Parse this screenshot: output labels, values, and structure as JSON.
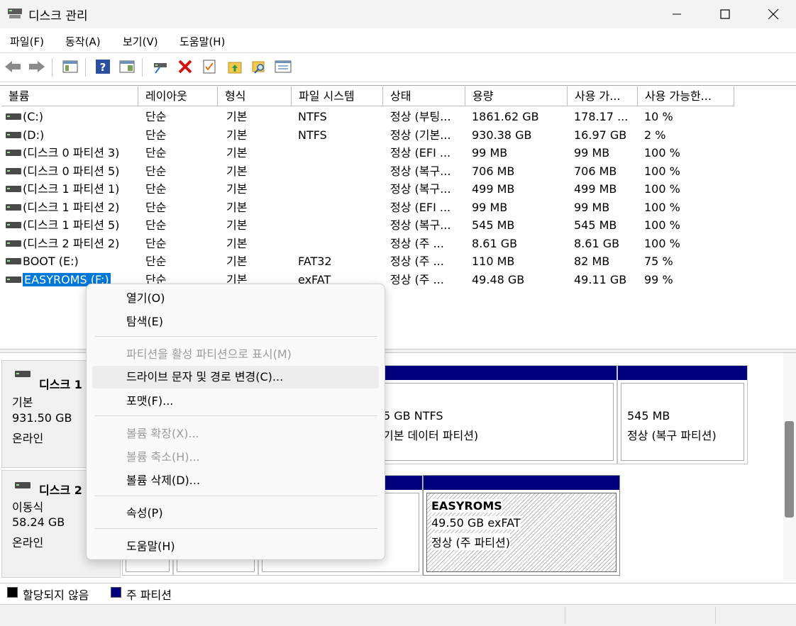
{
  "window": {
    "title": "디스크 관리"
  },
  "menubar": [
    "파일(F)",
    "동작(A)",
    "보기(V)",
    "도움말(H)"
  ],
  "toolbar": {
    "icons": [
      "back-arrow-icon",
      "forward-arrow-icon",
      "console-tree-icon",
      "help-icon",
      "show-action-pane-icon",
      "connect-drive-icon",
      "delete-icon",
      "properties-icon",
      "up-folder-icon",
      "search-folder-icon",
      "list-view-icon"
    ]
  },
  "volume_list": {
    "columns": [
      "볼륨",
      "레이아웃",
      "형식",
      "파일 시스템",
      "상태",
      "용량",
      "사용 가...",
      "사용 가능한..."
    ],
    "rows": [
      {
        "volume": "(C:)",
        "layout": "단순",
        "type": "기본",
        "fs": "NTFS",
        "status": "정상 (부팅...",
        "capacity": "1861.62 GB",
        "free": "178.17 ...",
        "pct": "10 %"
      },
      {
        "volume": "(D:)",
        "layout": "단순",
        "type": "기본",
        "fs": "NTFS",
        "status": "정상 (기본...",
        "capacity": "930.38 GB",
        "free": "16.97 GB",
        "pct": "2 %"
      },
      {
        "volume": "(디스크 0 파티션 3)",
        "layout": "단순",
        "type": "기본",
        "fs": "",
        "status": "정상 (EFI ...",
        "capacity": "99 MB",
        "free": "99 MB",
        "pct": "100 %"
      },
      {
        "volume": "(디스크 0 파티션 5)",
        "layout": "단순",
        "type": "기본",
        "fs": "",
        "status": "정상 (복구...",
        "capacity": "706 MB",
        "free": "706 MB",
        "pct": "100 %"
      },
      {
        "volume": "(디스크 1 파티션 1)",
        "layout": "단순",
        "type": "기본",
        "fs": "",
        "status": "정상 (복구...",
        "capacity": "499 MB",
        "free": "499 MB",
        "pct": "100 %"
      },
      {
        "volume": "(디스크 1 파티션 2)",
        "layout": "단순",
        "type": "기본",
        "fs": "",
        "status": "정상 (EFI ...",
        "capacity": "99 MB",
        "free": "99 MB",
        "pct": "100 %"
      },
      {
        "volume": "(디스크 1 파티션 5)",
        "layout": "단순",
        "type": "기본",
        "fs": "",
        "status": "정상 (복구...",
        "capacity": "545 MB",
        "free": "545 MB",
        "pct": "100 %"
      },
      {
        "volume": "(디스크 2 파티션 2)",
        "layout": "단순",
        "type": "기본",
        "fs": "",
        "status": "정상 (주 ...",
        "capacity": "8.61 GB",
        "free": "8.61 GB",
        "pct": "100 %"
      },
      {
        "volume": "BOOT (E:)",
        "layout": "단순",
        "type": "기본",
        "fs": "FAT32",
        "status": "정상 (주 ...",
        "capacity": "110 MB",
        "free": "82 MB",
        "pct": "75 %"
      },
      {
        "volume": "EASYROMS (F:)",
        "layout": "단순",
        "type": "기본",
        "fs": "exFAT",
        "status": "정상 (주 ...",
        "capacity": "49.48 GB",
        "free": "49.11 GB",
        "pct": "99 %",
        "selected": true
      }
    ]
  },
  "disks": [
    {
      "name": "디스크 1",
      "type": "기본",
      "size": "931.50 GB",
      "state": "온라인"
    },
    {
      "name": "디스크 2",
      "type": "이동식",
      "size": "58.24 GB",
      "state": "온라인"
    }
  ],
  "partitions": {
    "disk1_ntfs_line1": "5 GB NTFS",
    "disk1_ntfs_line2": "기본 데이터 파티션)",
    "disk1_recovery_line1": "545 MB",
    "disk1_recovery_line2": "정상 (복구 파티션)",
    "disk2_easyroms_name": "EASYROMS",
    "disk2_easyroms_line1": "49.50 GB exFAT",
    "disk2_easyroms_line2": "정상 (주 파티션)"
  },
  "legend": {
    "unallocated": "할당되지 않음",
    "primary": "주 파티션",
    "unallocated_color": "#000000",
    "primary_color": "#00007f"
  },
  "context_menu": {
    "items": [
      {
        "label": "열기(O)",
        "enabled": true
      },
      {
        "label": "탐색(E)",
        "enabled": true
      },
      {
        "label": "파티션을 활성 파티션으로 표시(M)",
        "enabled": false
      },
      {
        "label": "드라이브 문자 및 경로 변경(C)...",
        "enabled": true,
        "highlighted": true
      },
      {
        "label": "포맷(F)...",
        "enabled": true
      },
      {
        "label": "볼륨 확장(X)...",
        "enabled": false
      },
      {
        "label": "볼륨 축소(H)...",
        "enabled": false
      },
      {
        "label": "볼륨 삭제(D)...",
        "enabled": true
      },
      {
        "label": "속성(P)",
        "enabled": true
      },
      {
        "label": "도움말(H)",
        "enabled": true
      }
    ]
  },
  "colors": {
    "accent": "#0078d7",
    "partition_bar": "#00007f"
  }
}
